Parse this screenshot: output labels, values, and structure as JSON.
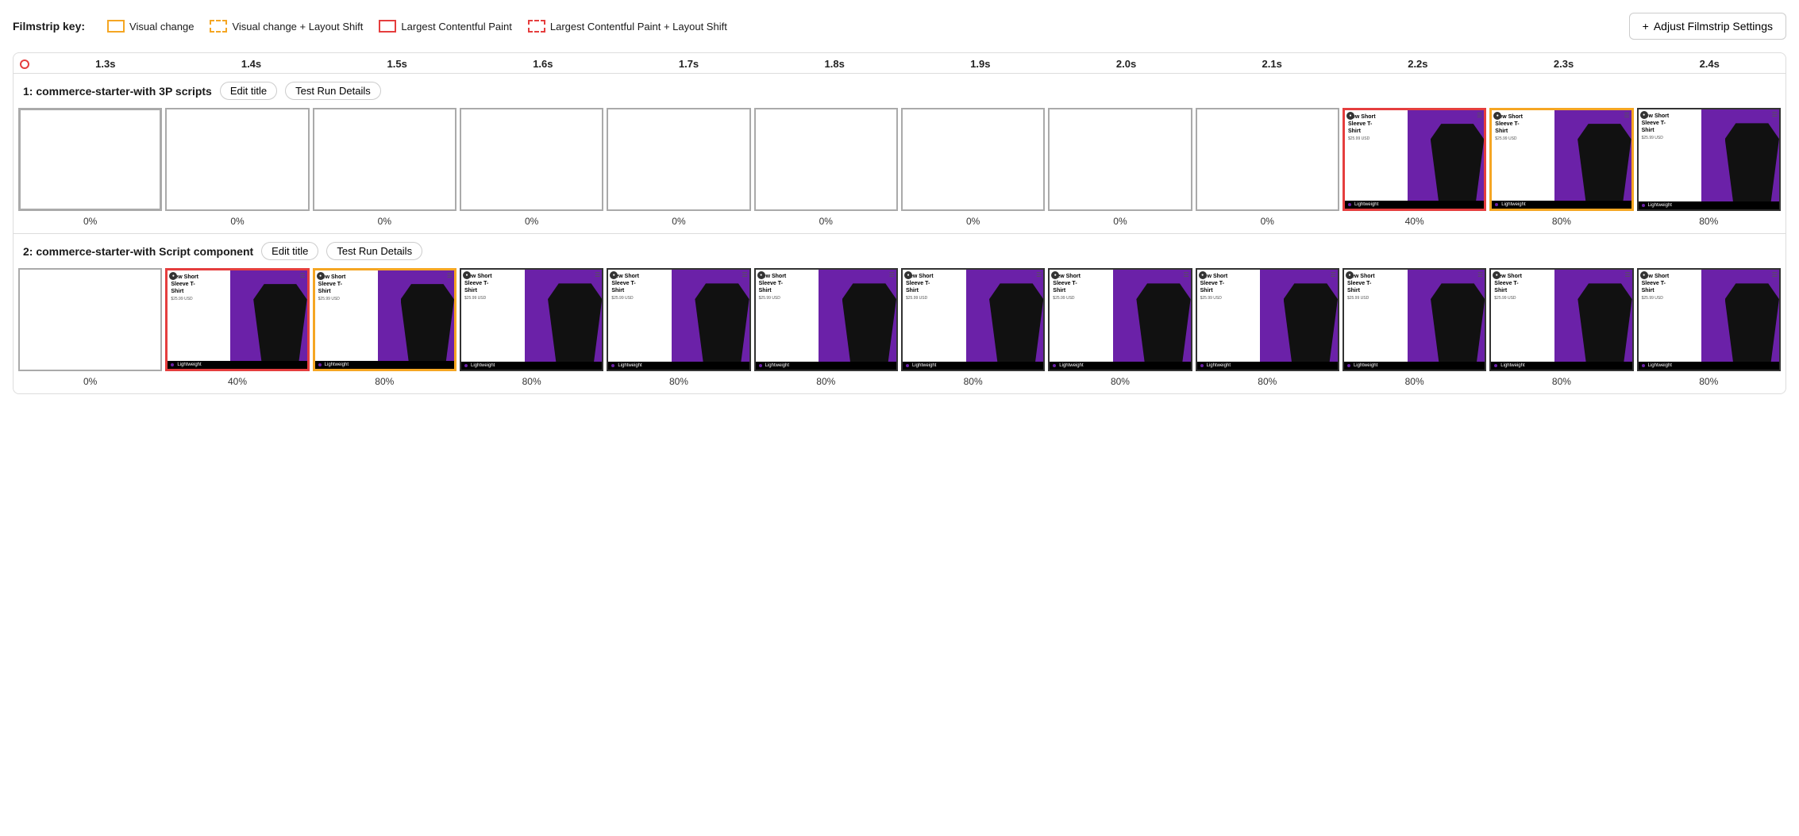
{
  "legend": {
    "key_label": "Filmstrip key:",
    "items": [
      {
        "id": "visual-change",
        "label": "Visual change",
        "style": "yellow"
      },
      {
        "id": "visual-change-layout-shift",
        "label": "Visual change + Layout Shift",
        "style": "yellow-dashed"
      },
      {
        "id": "lcp",
        "label": "Largest Contentful Paint",
        "style": "red"
      },
      {
        "id": "lcp-layout-shift",
        "label": "Largest Contentful Paint + Layout Shift",
        "style": "red-dashed"
      }
    ]
  },
  "adjust_button": {
    "label": "Adjust Filmstrip Settings",
    "icon": "+"
  },
  "timeline": {
    "ticks": [
      "1.3s",
      "1.4s",
      "1.5s",
      "1.6s",
      "1.7s",
      "1.8s",
      "1.9s",
      "2.0s",
      "2.1s",
      "2.2s",
      "2.3s",
      "2.4s"
    ]
  },
  "rows": [
    {
      "id": "row1",
      "title": "1: commerce-starter-with 3P scripts",
      "edit_title_label": "Edit title",
      "test_run_label": "Test Run Details",
      "frames": [
        {
          "type": "empty",
          "border": "red",
          "percent": "0%"
        },
        {
          "type": "empty",
          "border": "none",
          "percent": "0%"
        },
        {
          "type": "empty",
          "border": "none",
          "percent": "0%"
        },
        {
          "type": "empty",
          "border": "none",
          "percent": "0%"
        },
        {
          "type": "empty",
          "border": "none",
          "percent": "0%"
        },
        {
          "type": "empty",
          "border": "none",
          "percent": "0%"
        },
        {
          "type": "empty",
          "border": "none",
          "percent": "0%"
        },
        {
          "type": "empty",
          "border": "none",
          "percent": "0%"
        },
        {
          "type": "empty",
          "border": "none",
          "percent": "0%"
        },
        {
          "type": "product",
          "border": "red",
          "percent": "40%"
        },
        {
          "type": "product",
          "border": "yellow",
          "percent": "80%"
        },
        {
          "type": "product",
          "border": "none",
          "percent": "80%"
        }
      ]
    },
    {
      "id": "row2",
      "title": "2: commerce-starter-with Script component",
      "edit_title_label": "Edit title",
      "test_run_label": "Test Run Details",
      "frames": [
        {
          "type": "empty",
          "border": "none",
          "percent": "0%"
        },
        {
          "type": "product",
          "border": "red",
          "percent": "40%"
        },
        {
          "type": "product",
          "border": "yellow",
          "percent": "80%"
        },
        {
          "type": "product",
          "border": "none",
          "percent": "80%"
        },
        {
          "type": "product",
          "border": "none",
          "percent": "80%"
        },
        {
          "type": "product",
          "border": "none",
          "percent": "80%"
        },
        {
          "type": "product",
          "border": "none",
          "percent": "80%"
        },
        {
          "type": "product",
          "border": "none",
          "percent": "80%"
        },
        {
          "type": "product",
          "border": "none",
          "percent": "80%"
        },
        {
          "type": "product",
          "border": "none",
          "percent": "80%"
        },
        {
          "type": "product",
          "border": "none",
          "percent": "80%"
        },
        {
          "type": "product",
          "border": "none",
          "percent": "80%"
        }
      ]
    }
  ],
  "product": {
    "title_line1": "New Short",
    "title_line2": "Sleeve T-",
    "title_line3": "Shirt",
    "price": "$25.99 USD",
    "bottom_label": "Lightweight"
  }
}
